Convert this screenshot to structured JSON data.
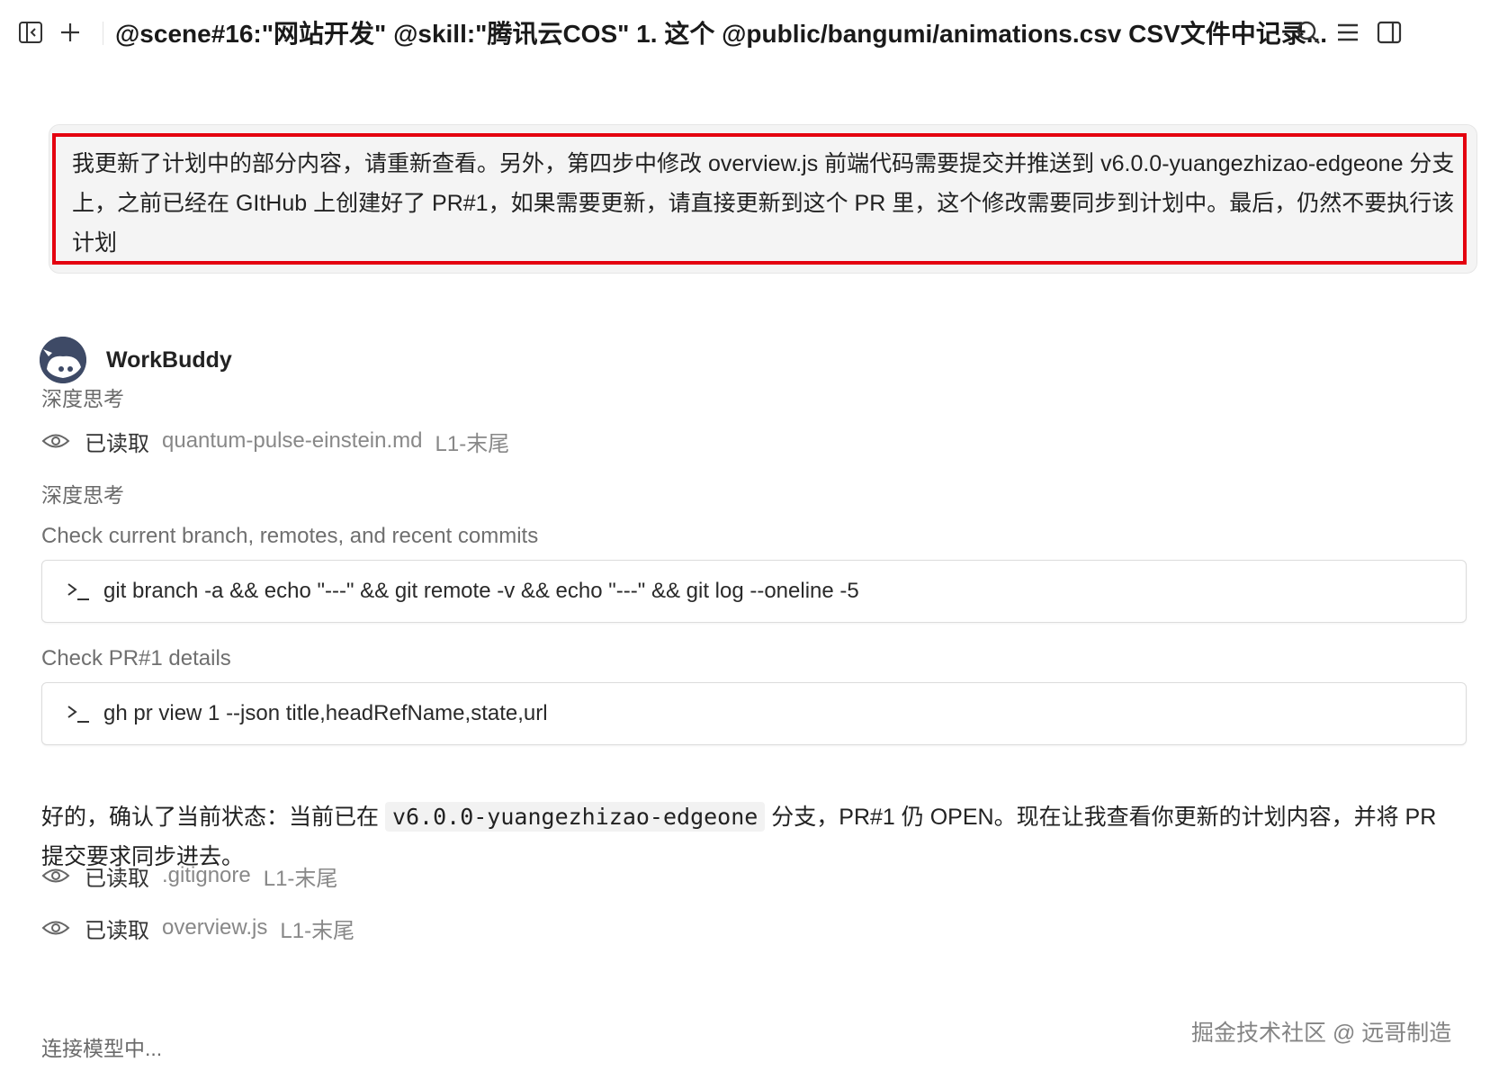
{
  "topbar": {
    "title": "@scene#16:\"网站开发\" @skill:\"腾讯云COS\" 1. 这个 @public/bangumi/animations.csv CSV文件中记录..."
  },
  "user_message": {
    "text": "我更新了计划中的部分内容，请重新查看。另外，第四步中修改 overview.js 前端代码需要提交并推送到 v6.0.0-yuangezhizao-edgeone 分支上，之前已经在 GItHub 上创建好了 PR#1，如果需要更新，请直接更新到这个 PR 里，这个修改需要同步到计划中。最后，仍然不要执行该计划"
  },
  "bot": {
    "name": "WorkBuddy"
  },
  "thinking_label_1": "深度思考",
  "read_1": {
    "label": "已读取",
    "file": "quantum-pulse-einstein.md",
    "range": "L1-末尾"
  },
  "thinking_label_2": "深度思考",
  "step_1": {
    "title": "Check current branch, remotes, and recent commits",
    "command": "git branch -a && echo \"---\" && git remote -v && echo \"---\" && git log --oneline -5"
  },
  "step_2": {
    "title": "Check PR#1 details",
    "command": "gh pr view 1 --json title,headRefName,state,url"
  },
  "reply": {
    "before": "好的，确认了当前状态：当前已在 ",
    "code": "v6.0.0-yuangezhizao-edgeone",
    "after": " 分支，PR#1 仍 OPEN。现在让我查看你更新的计划内容，并将 PR 提交要求同步进去。"
  },
  "read_2": {
    "label": "已读取",
    "file": ".gitignore",
    "range": "L1-末尾"
  },
  "read_3": {
    "label": "已读取",
    "file": "overview.js",
    "range": "L1-末尾"
  },
  "connecting": "连接模型中...",
  "watermark": "掘金技术社区 @ 远哥制造",
  "colors": {
    "highlight": "#e4000f",
    "avatar": "#3e4a66"
  }
}
